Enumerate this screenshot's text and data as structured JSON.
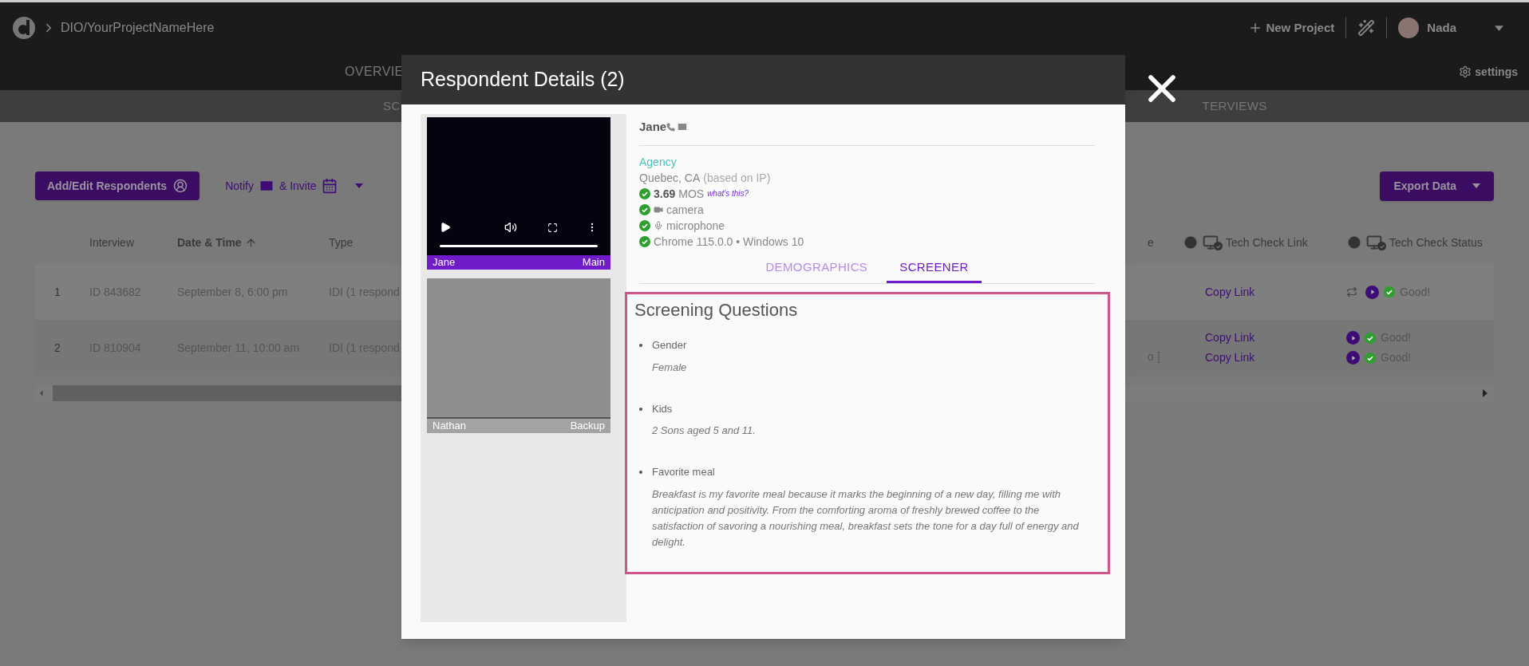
{
  "topbar": {
    "breadcrumb": "DIO/YourProjectNameHere",
    "new_project": "New Project",
    "user": "Nada"
  },
  "nav": {
    "tabs": [
      "OVERVIE"
    ],
    "settings": "settings"
  },
  "subnav": {
    "tabs": [
      "SC",
      "TERVIEWS"
    ]
  },
  "toolbar": {
    "add_button": "Add/Edit Respondents",
    "notify": "Notify",
    "invite": "& Invite",
    "export_button": "Export Data"
  },
  "table": {
    "columns": [
      {
        "label": "Interview",
        "sorted": false
      },
      {
        "label": "Date & Time",
        "sorted": true
      },
      {
        "label": "Type",
        "sorted": false
      }
    ],
    "right_columns": [
      {
        "label": "e",
        "kind": "plain"
      },
      {
        "label": "Tech Check Link",
        "kind": "tech"
      },
      {
        "label": "Tech Check Status",
        "kind": "tech"
      }
    ],
    "rows": [
      {
        "number": "1",
        "interview": "ID 843682",
        "date": "September 8, 6:00 pm",
        "type": "IDI (1 respond",
        "column_4": [],
        "links": [
          "Copy Link"
        ],
        "statuses": [
          {
            "repeat": true,
            "status": "Good!"
          }
        ]
      },
      {
        "number": "2",
        "interview": "ID 810904",
        "date": "September 11, 10:00 am",
        "type": "IDI (1 respond",
        "column_4": [
          "o ]"
        ],
        "links": [
          "Copy Link",
          "Copy Link"
        ],
        "statuses": [
          {
            "repeat": false,
            "status": "Good!"
          },
          {
            "repeat": false,
            "status": "Good!"
          }
        ]
      }
    ]
  },
  "modal": {
    "title": "Respondent Details (2)",
    "videos": [
      {
        "kind": "video",
        "name": "Jane",
        "role": "Main"
      },
      {
        "kind": "empty",
        "name": "Nathan",
        "role": "Backup"
      }
    ],
    "respondent": {
      "name": "Jane",
      "group": "Agency",
      "location": "Quebec, CA",
      "location_note": "(based on IP)",
      "mos": "3.69",
      "mos_label": "MOS",
      "mos_help": "what's this?",
      "checks": [
        {
          "kind": "camera",
          "label": "camera",
          "ok": true
        },
        {
          "kind": "microphone",
          "label": "microphone",
          "ok": true
        },
        {
          "kind": "browser",
          "label": "Chrome 115.0.0 • Windows 10",
          "ok": true
        }
      ]
    },
    "tabs": [
      {
        "label": "DEMOGRAPHICS",
        "selected": false
      },
      {
        "label": "SCREENER",
        "selected": true
      }
    ],
    "screener": {
      "title": "Screening Questions",
      "questions": [
        {
          "question": "Gender",
          "answer": "Female"
        },
        {
          "question": "Kids",
          "answer": "2 Sons aged 5 and 11."
        },
        {
          "question": "Favorite meal",
          "answer": "Breakfast is my favorite meal because it marks the beginning of a new day, filling me with anticipation and positivity. From the comforting aroma of freshly brewed coffee to the satisfaction of savoring a nourishing meal, breakfast sets the tone for a day full of energy and delight."
        }
      ]
    }
  }
}
